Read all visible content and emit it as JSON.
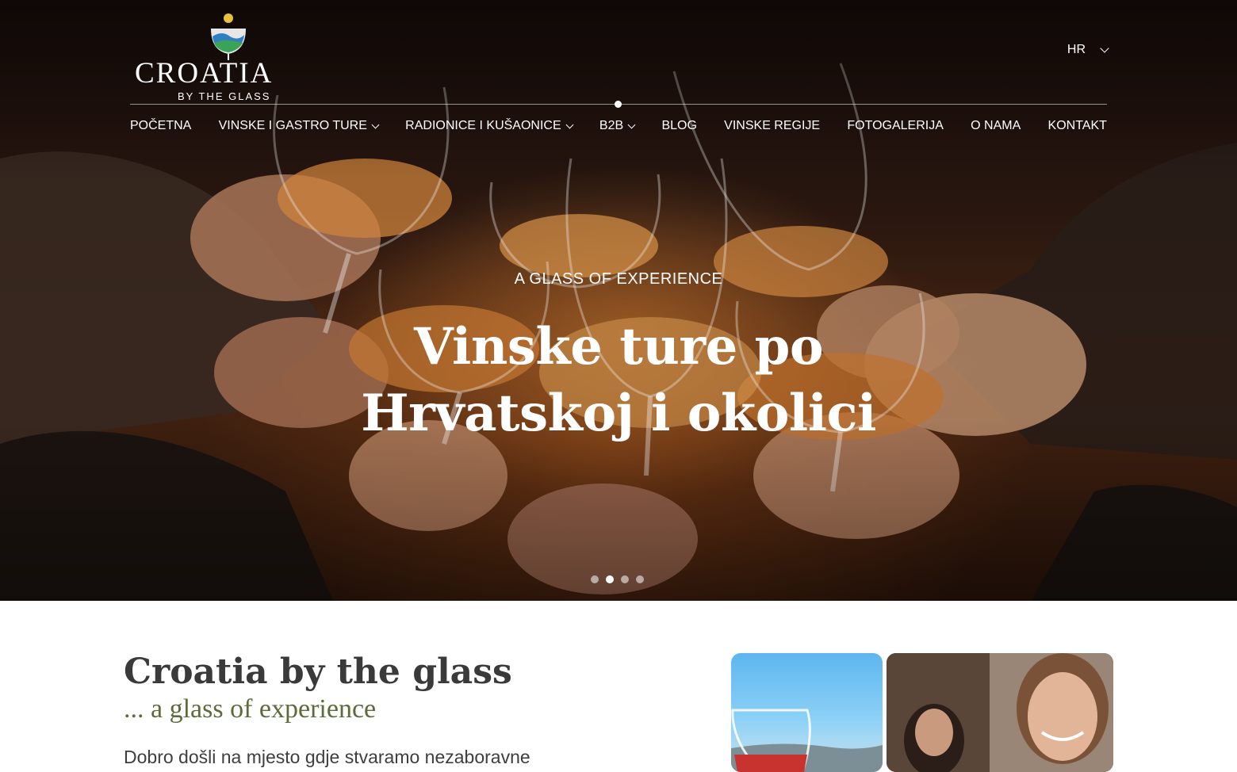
{
  "header": {
    "logo": {
      "word": "CROATIA",
      "sub": "BY THE GLASS"
    },
    "language": "HR",
    "nav": [
      {
        "label": "POČETNA",
        "dropdown": false
      },
      {
        "label": "VINSKE I GASTRO TURE",
        "dropdown": true
      },
      {
        "label": "RADIONICE I KUŠAONICE",
        "dropdown": true
      },
      {
        "label": "B2B",
        "dropdown": true
      },
      {
        "label": "BLOG",
        "dropdown": false
      },
      {
        "label": "VINSKE REGIJE",
        "dropdown": false
      },
      {
        "label": "FOTOGALERIJA",
        "dropdown": false
      },
      {
        "label": "O NAMA",
        "dropdown": false
      },
      {
        "label": "KONTAKT",
        "dropdown": false
      }
    ]
  },
  "hero": {
    "kicker": "A GLASS OF EXPERIENCE",
    "headline_line1": "Vinske ture po",
    "headline_line2": "Hrvatskoj i okolici",
    "slides_total": 4,
    "slide_active": 2
  },
  "intro": {
    "title": "Croatia by the glass",
    "subtitle": "... a glass of experience",
    "text": "Dobro došli na mjesto gdje stvaramo nezaboravne"
  },
  "icons": {
    "dropdown": "chevron-down-icon",
    "logo_mark": "wine-glass-logo-icon"
  }
}
